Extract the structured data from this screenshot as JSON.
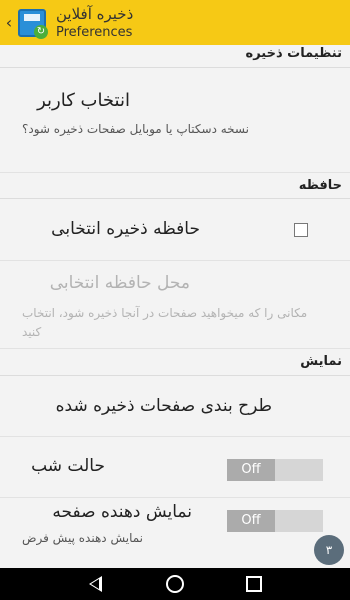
{
  "appbar": {
    "back_glyph": "‹",
    "icon": "app-floppy-icon",
    "title": "ذخیره آفلاین",
    "subtitle": "Preferences"
  },
  "sections": {
    "save_settings": {
      "title": "تنظیمات ذخیره",
      "select_user": {
        "title": "انتخاب کاربر",
        "summary": "نسخه دسکتاپ یا موبایل صفحات ذخیره شود؟"
      }
    },
    "memory": {
      "title": "حافظه",
      "selective_memory": {
        "title": "حافظه ذخیره انتخابی",
        "checked": false
      },
      "memory_location": {
        "title": "محل حافظه انتخابی",
        "summary": "مکانی را که میخواهید صفحات در آنجا ذخیره شود، انتخاب کنید",
        "enabled": false
      }
    },
    "display": {
      "title": "نمایش",
      "saved_layout": {
        "title": "طرح بندی صفحات ذخیره شده"
      },
      "night_mode": {
        "title": "حالت شب",
        "state": "Off"
      },
      "page_display": {
        "title": "نمایش دهنده صفحه",
        "summary": "نمایش دهنده پیش فرض",
        "state": "Off"
      }
    }
  },
  "navbar": {
    "back": "back-icon",
    "home": "home-icon",
    "recents": "recents-icon"
  },
  "watermark": {
    "text": "۳"
  }
}
